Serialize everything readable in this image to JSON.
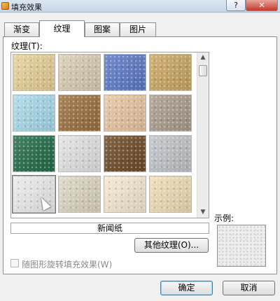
{
  "window": {
    "title": "填充效果",
    "help": "?",
    "close": "✕"
  },
  "tabs": [
    "渐变",
    "纹理",
    "图案",
    "图片"
  ],
  "active_tab": "纹理",
  "texture_section": {
    "label": "纹理(T):",
    "selected_name": "新闻纸",
    "swatch_colors": [
      [
        "#e7cf95",
        "#d9ccb0",
        "#5b79c6",
        "#c9a660"
      ],
      [
        "#a6d9ea",
        "#9b6f3d",
        "#e7c59f",
        "#a99c8d"
      ],
      [
        "#226c47",
        "#e2e2e2",
        "#6e4a26",
        "#bfc3c7"
      ],
      [
        "#ebebeb",
        "#dcd5c0",
        "#f5e8cf",
        "#efdcb4"
      ]
    ]
  },
  "buttons": {
    "other_textures": "其他纹理(O)...",
    "ok": "确定",
    "cancel": "取消"
  },
  "preview": {
    "label": "示例:"
  },
  "rotate_option": {
    "label": "随图形旋转填充效果(W)",
    "checked": false,
    "enabled": false
  }
}
